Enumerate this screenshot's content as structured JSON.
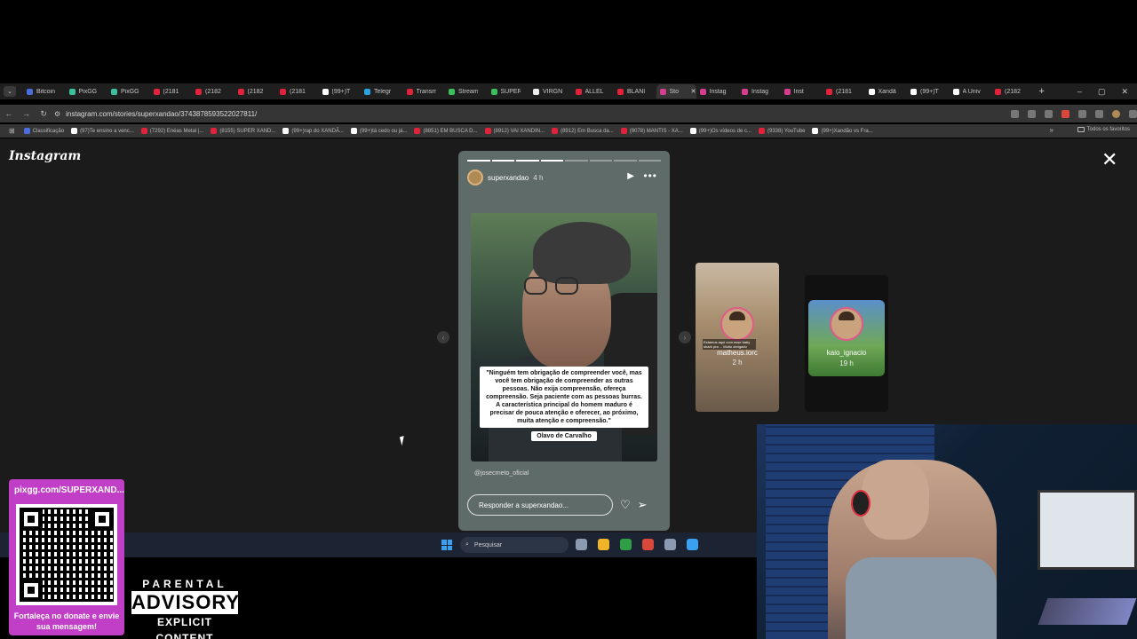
{
  "browser": {
    "tabs": [
      {
        "label": "Bitcoin",
        "color": "#4a6ee0"
      },
      {
        "label": "PixGG",
        "color": "#3bbf9e"
      },
      {
        "label": "PixGG",
        "color": "#3bbf9e"
      },
      {
        "label": "(2181",
        "color": "#e0223a"
      },
      {
        "label": "(2182",
        "color": "#e0223a"
      },
      {
        "label": "(2182",
        "color": "#e0223a"
      },
      {
        "label": "(2181",
        "color": "#e0223a"
      },
      {
        "label": "(99+)T",
        "color": "#ffffff"
      },
      {
        "label": "Telegr",
        "color": "#2aa3e0"
      },
      {
        "label": "Transm",
        "color": "#e0223a"
      },
      {
        "label": "Stream",
        "color": "#3bbf5a"
      },
      {
        "label": "SUPER",
        "color": "#3bbf5a"
      },
      {
        "label": "VIRGN",
        "color": "#eeeeee"
      },
      {
        "label": "ALLEL",
        "color": "#e0223a"
      },
      {
        "label": "BLANI",
        "color": "#e0223a"
      },
      {
        "label": "Sto",
        "color": "#d63d8e",
        "active": true
      },
      {
        "label": "Instag",
        "color": "#d63d8e"
      },
      {
        "label": "Instag",
        "color": "#d63d8e"
      },
      {
        "label": "Inst",
        "color": "#d63d8e"
      },
      {
        "label": "(2181",
        "color": "#e0223a"
      },
      {
        "label": "Xandã",
        "color": "#ffffff"
      },
      {
        "label": "(99+)T",
        "color": "#ffffff"
      },
      {
        "label": "A Úniv",
        "color": "#ffffff"
      },
      {
        "label": "(2182",
        "color": "#e0223a"
      }
    ],
    "new_tab": "+",
    "tab_close": "✕",
    "tab_list": "⌄",
    "minimize": "–",
    "maximize": "▢",
    "close": "✕",
    "back": "←",
    "forward": "→",
    "reload": "↻",
    "url": "instagram.com/stories/superxandao/3743878593522027811/",
    "bookmarks": [
      {
        "label": "Classificação",
        "color": "#4a6ee0"
      },
      {
        "label": "(97)Te ensino a venc...",
        "color": "#ffffff"
      },
      {
        "label": "(7292) Enéas Metal |...",
        "color": "#e0223a"
      },
      {
        "label": "(8155) SUPER XAND...",
        "color": "#e0223a"
      },
      {
        "label": "(99+)rap do XANDÃ...",
        "color": "#ffffff"
      },
      {
        "label": "(99+)tá cedo ou já...",
        "color": "#ffffff"
      },
      {
        "label": "(8851) EM BUSCA D...",
        "color": "#e0223a"
      },
      {
        "label": "(8912) VAI XANDIN...",
        "color": "#e0223a"
      },
      {
        "label": "(8912) Em Busca da...",
        "color": "#e0223a"
      },
      {
        "label": "(9078) MANTIS - XA...",
        "color": "#e0223a"
      },
      {
        "label": "(99+)Os vídeos de c...",
        "color": "#ffffff"
      },
      {
        "label": "(9338) YouTube",
        "color": "#e0223a"
      },
      {
        "label": "(99+)Xandão vs Fra...",
        "color": "#ffffff"
      }
    ],
    "bookmarks_more": "»",
    "all_bookmarks": "Todos os favoritos"
  },
  "instagram": {
    "logo": "Instagram",
    "close": "✕",
    "story": {
      "username": "superxandao",
      "time": "4 h",
      "play": "▶",
      "more": "•••",
      "quote": "\"Ninguém tem obrigação de compreender você, mas você tem obrigação de compreender as outras pessoas. Não exija compreensão, ofereça compreensão. Seja paciente com as pessoas burras. A característica principal do homem maduro é precisar de pouca atenção e oferecer, ao próximo, muita atenção e compreensão.\"",
      "quote_author": "Olavo de Carvalho",
      "credit": "@josecrneto_oficial",
      "reply_placeholder": "Responder a superxandao...",
      "progress_segments": 8,
      "progress_done": 4
    },
    "next_stories": [
      {
        "name": "matheus.iorc",
        "time": "2 h",
        "overlay": "Estamos aqui com esse baby shark pra ... Muito obrigado"
      },
      {
        "name": "kaio_ignacio",
        "time": "19 h"
      }
    ],
    "prev_arrow": "‹",
    "next_arrow": "›"
  },
  "taskbar": {
    "search_placeholder": "Pesquisar",
    "apps": [
      "#8a9ab0",
      "#f0b429",
      "#2f9e44",
      "#d9483b",
      "#8a9ab0",
      "#3aa0f0"
    ]
  },
  "overlay": {
    "pix_url": "pixgg.com/SUPERXAND...",
    "pix_message": "Fortaleça no donate e envie sua mensagem!",
    "advisory_top": "PARENTAL",
    "advisory_mid": "ADVISORY",
    "advisory_bot": "EXPLICIT CONTENT"
  }
}
